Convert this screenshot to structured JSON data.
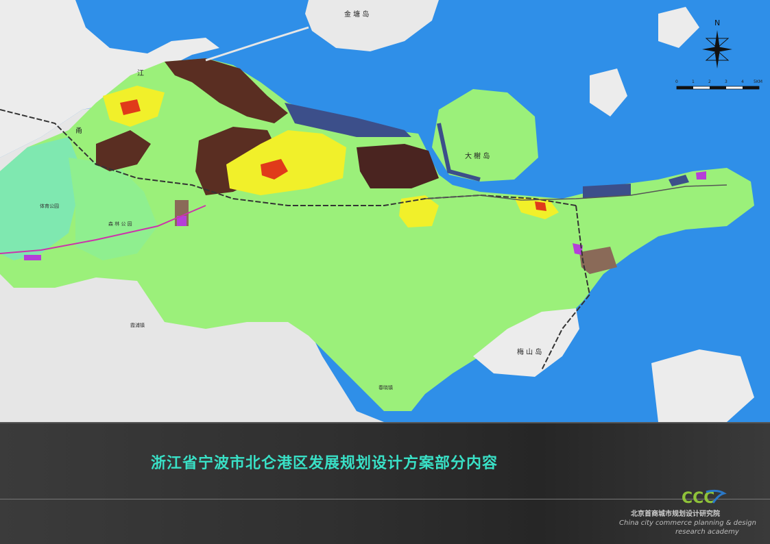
{
  "title": "浙江省宁波市北仑港区发展规划设计方案部分内容",
  "organization": {
    "name_cn": "北京首商城市规划设计研究院",
    "name_en_line1": "China city commerce planning & design",
    "name_en_line2": "research academy",
    "logo_text": "CCC"
  },
  "compass": {
    "label": "N"
  },
  "scale_bar": {
    "labels": [
      "0",
      "1",
      "2",
      "3",
      "4",
      "5KM"
    ]
  },
  "places": {
    "jintang": "金 塘 岛",
    "meishan": "梅 山 岛",
    "damashan": "大 榭 岛",
    "tiyu": "体育公园",
    "senlin": "森 林 公 园",
    "yong": "甬",
    "jiang": "江",
    "xiapu": "霞浦镇",
    "fenghua": "春晓镇"
  },
  "colors": {
    "sea": "#2f8fe8",
    "land_base": "#ededed",
    "green_space": "#9bf07a",
    "park": "#7fe8b0",
    "industry": "#5a2e22",
    "residential": "#f1f02a",
    "commercial": "#e03a1a",
    "storage": "#8a6a58",
    "port": "#3c4f8a",
    "utility": "#b53fd8",
    "title": "#39e0c6"
  }
}
